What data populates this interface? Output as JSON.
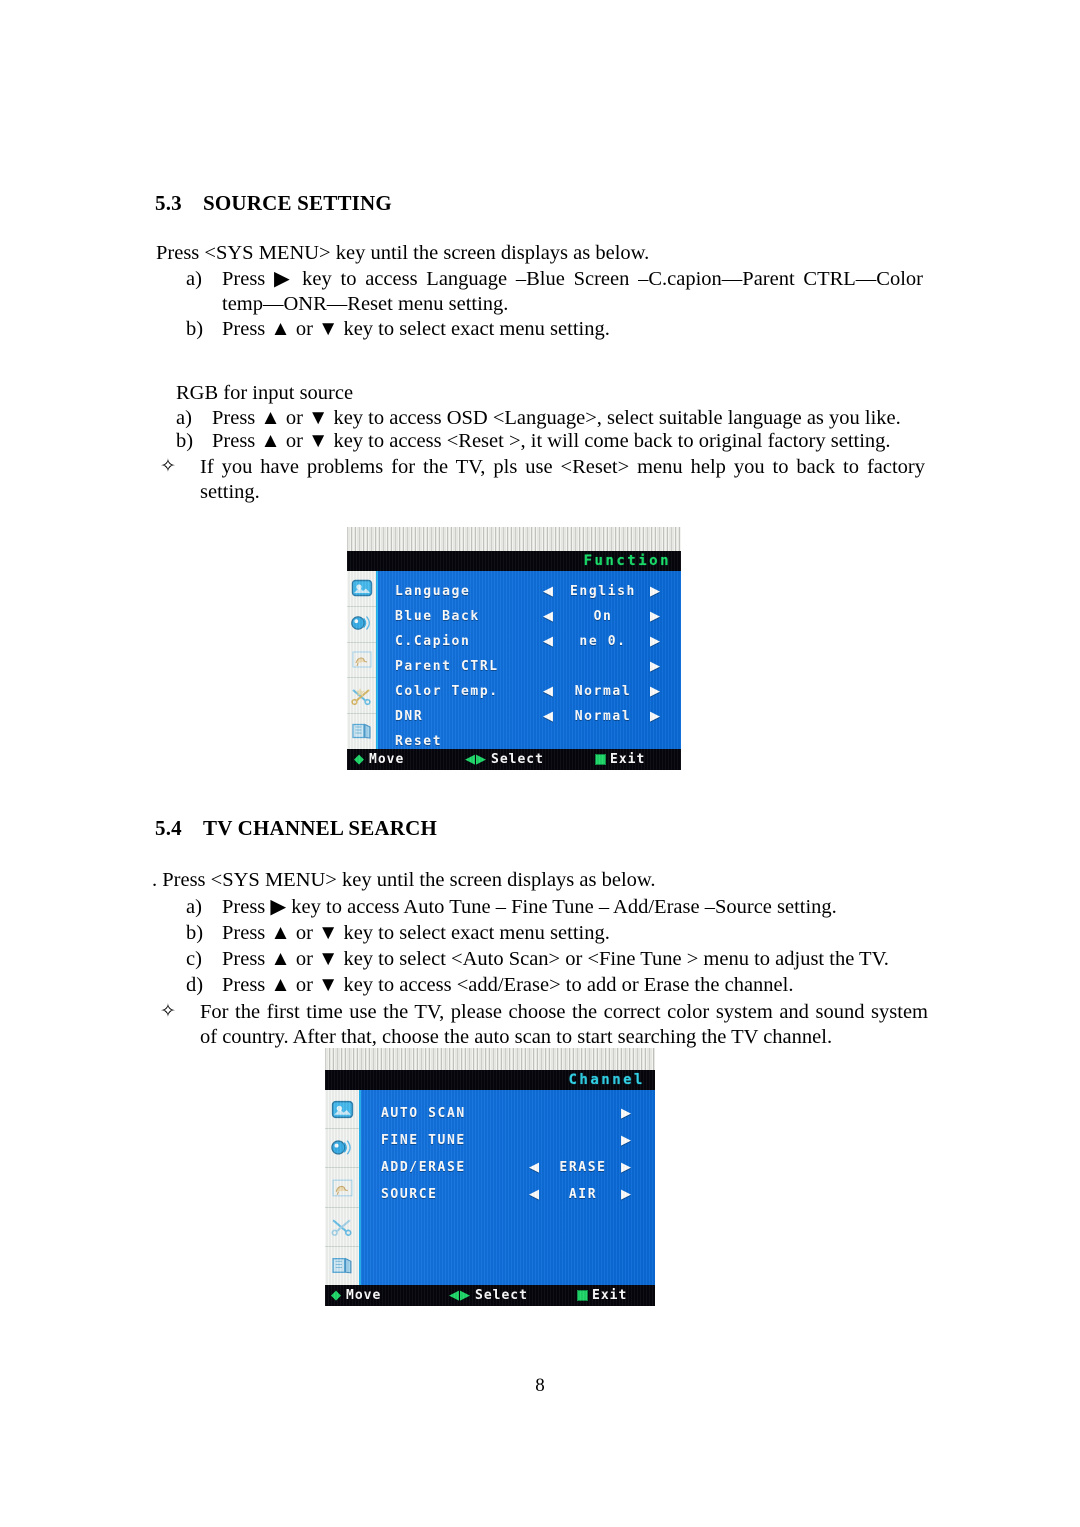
{
  "sections": {
    "source_setting": {
      "number": "5.3",
      "title": "SOURCE SETTING",
      "lead": "Press <SYS MENU> key until the screen displays as below.",
      "items": [
        {
          "marker": "a)",
          "text": "Press ▶ key to access Language –Blue Screen –C.capion—Parent CTRL—Color temp—ONR—Reset menu setting."
        },
        {
          "marker": "b)",
          "text": "Press ▲ or ▼ key to select exact menu setting."
        }
      ],
      "subhead": "RGB for input source",
      "sub_items": [
        {
          "marker": "a)",
          "text": "Press ▲ or ▼ key to access OSD <Language>, select suitable language as you like."
        },
        {
          "marker": "b)",
          "text": "Press ▲ or ▼ key to access <Reset >, it will come back to original factory setting."
        }
      ],
      "note": {
        "marker": "✧",
        "text": "If you have problems for the TV, pls use <Reset> menu help you to back to factory setting."
      }
    },
    "tv_channel_search": {
      "number": "5.4",
      "title": "TV CHANNEL SEARCH",
      "lead": ". Press <SYS MENU> key until the screen displays as below.",
      "items": [
        {
          "marker": "a)",
          "text": "Press ▶ key to access Auto Tune – Fine Tune – Add/Erase –Source setting."
        },
        {
          "marker": "b)",
          "text": "Press ▲ or ▼ key to select exact menu setting."
        },
        {
          "marker": "c)",
          "text": "Press ▲ or ▼ key to select <Auto Scan> or <Fine Tune > menu to adjust the TV."
        },
        {
          "marker": "d)",
          "text": "Press ▲ or ▼ key to access <add/Erase> to add or Erase the channel."
        }
      ],
      "note": {
        "marker": "✧",
        "text": "For the first time use the TV, please choose the correct color system and sound system of country. After that, choose the auto scan to start searching the TV channel."
      }
    }
  },
  "osd_function": {
    "title": "Function",
    "title_color": "#18e06a",
    "background_color": "#0a6fe0",
    "left_arrow": "◀",
    "right_arrow": "▶",
    "rows": [
      {
        "label": "Language",
        "value": "English",
        "has_left": true,
        "has_right": true
      },
      {
        "label": "Blue Back",
        "value": "On",
        "has_left": true,
        "has_right": true
      },
      {
        "label": "C.Capion",
        "value": "ne 0.",
        "has_left": true,
        "has_right": true
      },
      {
        "label": "Parent CTRL",
        "value": "",
        "has_left": false,
        "has_right": true
      },
      {
        "label": "Color Temp.",
        "value": "Normal",
        "has_left": true,
        "has_right": true
      },
      {
        "label": "DNR",
        "value": "Normal",
        "has_left": true,
        "has_right": true
      },
      {
        "label": "Reset",
        "value": "",
        "has_left": false,
        "has_right": false
      }
    ],
    "footer": [
      {
        "glyph": "◆",
        "label": "Move"
      },
      {
        "glyph": "◀▶",
        "label": "Select"
      },
      {
        "glyph": "box",
        "label": "Exit"
      }
    ],
    "sidebar_icons": [
      "picture-icon",
      "sound-icon",
      "flag-icon",
      "tools-icon",
      "screen-icon"
    ]
  },
  "osd_channel": {
    "title": "Channel",
    "title_color": "#2fd3e8",
    "background_color": "#0a6fe0",
    "left_arrow": "◀",
    "right_arrow": "▶",
    "rows": [
      {
        "label": "AUTO SCAN",
        "value": "",
        "has_left": false,
        "has_right": true
      },
      {
        "label": "FINE TUNE",
        "value": "",
        "has_left": false,
        "has_right": true
      },
      {
        "label": "ADD/ERASE",
        "value": "ERASE",
        "has_left": true,
        "has_right": true
      },
      {
        "label": "SOURCE",
        "value": "AIR",
        "has_left": true,
        "has_right": true
      }
    ],
    "footer": [
      {
        "glyph": "◆",
        "label": "Move"
      },
      {
        "glyph": "◀▶",
        "label": "Select"
      },
      {
        "glyph": "box",
        "label": "Exit"
      }
    ],
    "sidebar_icons": [
      "picture-icon",
      "sound-icon",
      "flag-icon",
      "tools-icon",
      "screen-icon"
    ]
  },
  "footer": {
    "page_number": "8"
  }
}
